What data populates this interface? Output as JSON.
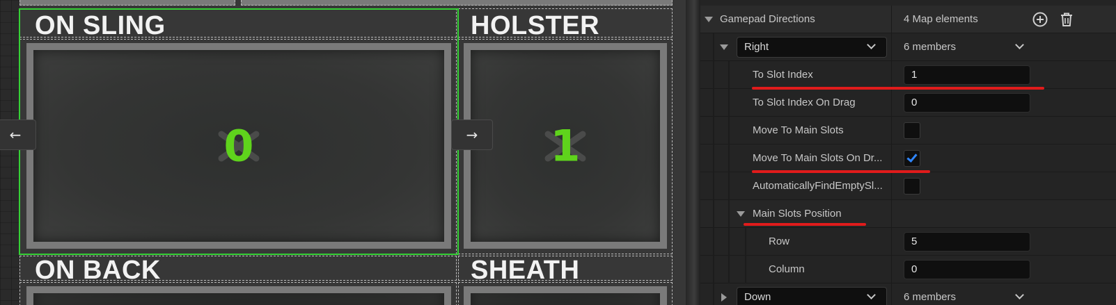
{
  "designer": {
    "cells": [
      {
        "label": "ON SLING",
        "slot_index": "0"
      },
      {
        "label": "HOLSTER",
        "slot_index": "1"
      },
      {
        "label": "ON BACK"
      },
      {
        "label": "SHEATH"
      }
    ],
    "nav": {
      "left_arrow": "←",
      "right_arrow": "→"
    }
  },
  "details": {
    "gamepad_directions": {
      "label": "Gamepad Directions",
      "summary": "4 Map elements",
      "add_icon": "add-circle-icon",
      "delete_icon": "trash-icon"
    },
    "right_entry": {
      "key": "Right",
      "summary": "6 members"
    },
    "properties": {
      "to_slot_index": {
        "label": "To Slot Index",
        "value": "1"
      },
      "to_slot_index_on_drag": {
        "label": "To Slot Index On Drag",
        "value": "0"
      },
      "move_to_main_slots": {
        "label": "Move To Main Slots",
        "checked": false
      },
      "move_to_main_slots_on_drag": {
        "label": "Move To Main Slots On Dr...",
        "checked": true
      },
      "automatically_find_empty": {
        "label": "AutomaticallyFindEmptySl...",
        "checked": false
      }
    },
    "main_slots_position": {
      "label": "Main Slots Position",
      "row_label": "Row",
      "row_value": "5",
      "column_label": "Column",
      "column_value": "0"
    },
    "down_entry": {
      "key": "Down",
      "summary": "6 members"
    }
  },
  "colors": {
    "accent_green": "#5fd31c",
    "selection": "#36d136",
    "annotation_red": "#e01b1b",
    "checkbox_blue": "#2f86ff"
  }
}
